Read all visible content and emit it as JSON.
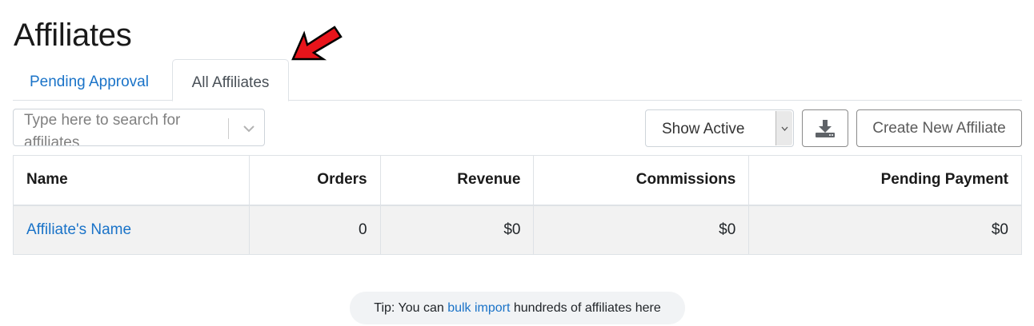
{
  "page": {
    "title": "Affiliates"
  },
  "tabs": [
    {
      "label": "Pending Approval",
      "active": false
    },
    {
      "label": "All Affiliates",
      "active": true
    }
  ],
  "search": {
    "placeholder": "Type here to search for affiliates",
    "value": ""
  },
  "filter": {
    "selected": "Show Active"
  },
  "toolbar": {
    "download_icon": "download-icon",
    "create_label": "Create New Affiliate"
  },
  "table": {
    "columns": [
      "Name",
      "Orders",
      "Revenue",
      "Commissions",
      "Pending Payment"
    ],
    "rows": [
      {
        "name": "Affiliate's Name",
        "orders": "0",
        "revenue": "$0",
        "commissions": "$0",
        "pending_payment": "$0"
      }
    ]
  },
  "tip": {
    "prefix": "Tip: You can ",
    "link": "bulk import",
    "suffix": " hundreds of affiliates here"
  },
  "colors": {
    "link": "#1a73c8",
    "annotation_arrow": "#e8141b",
    "row_bg": "#f2f2f2",
    "tip_bg": "#f1f3f5"
  }
}
